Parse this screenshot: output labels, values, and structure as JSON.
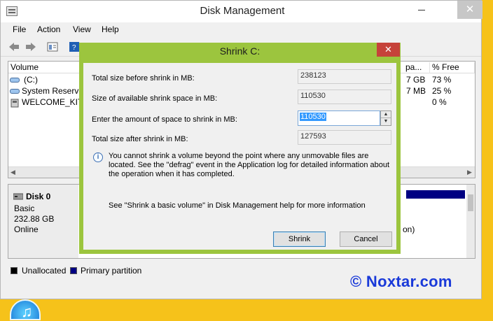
{
  "window": {
    "title": "Disk Management",
    "close_glyph": "✕"
  },
  "menu": [
    "File",
    "Action",
    "View",
    "Help"
  ],
  "volume_list": {
    "columns": [
      "Volume",
      "pa...",
      "% Free"
    ],
    "rows": [
      {
        "name": "(C:)",
        "free": "7 GB",
        "pct": "73 %"
      },
      {
        "name": "System Reserve",
        "free": "7 MB",
        "pct": "25 %"
      },
      {
        "name": "WELCOME_KIT_",
        "free": "",
        "pct": "0 %"
      }
    ]
  },
  "disk": {
    "name": "Disk 0",
    "type": "Basic",
    "size": "232.88 GB",
    "status": "Online",
    "partition_note": "on)"
  },
  "legend": [
    {
      "label": "Unallocated",
      "color": "#000000"
    },
    {
      "label": "Primary partition",
      "color": "#000082"
    }
  ],
  "watermark": "© Noxtar.com",
  "dialog": {
    "title": "Shrink C:",
    "close_glyph": "✕",
    "labels": {
      "total_before": "Total size before shrink in MB:",
      "available": "Size of available shrink space in MB:",
      "enter_amount": "Enter the amount of space to shrink in MB:",
      "total_after": "Total size after shrink in MB:"
    },
    "values": {
      "total_before": "238123",
      "available": "110530",
      "amount": "110530",
      "total_after": "127593"
    },
    "info_text": "You cannot shrink a volume beyond the point where any unmovable files are located. See the \"defrag\" event in the Application log for detailed information about the operation when it has completed.",
    "help_text": "See \"Shrink a basic volume\" in Disk Management help for more information",
    "buttons": {
      "shrink": "Shrink",
      "cancel": "Cancel"
    }
  },
  "colors": {
    "dialog_frame": "#9cc53e",
    "desktop": "#f6c21a",
    "primary_partition": "#000082"
  },
  "icons": [
    "back-arrow-icon",
    "forward-arrow-icon",
    "properties-icon",
    "help-icon",
    "disk-icon",
    "info-icon",
    "itunes-icon"
  ]
}
